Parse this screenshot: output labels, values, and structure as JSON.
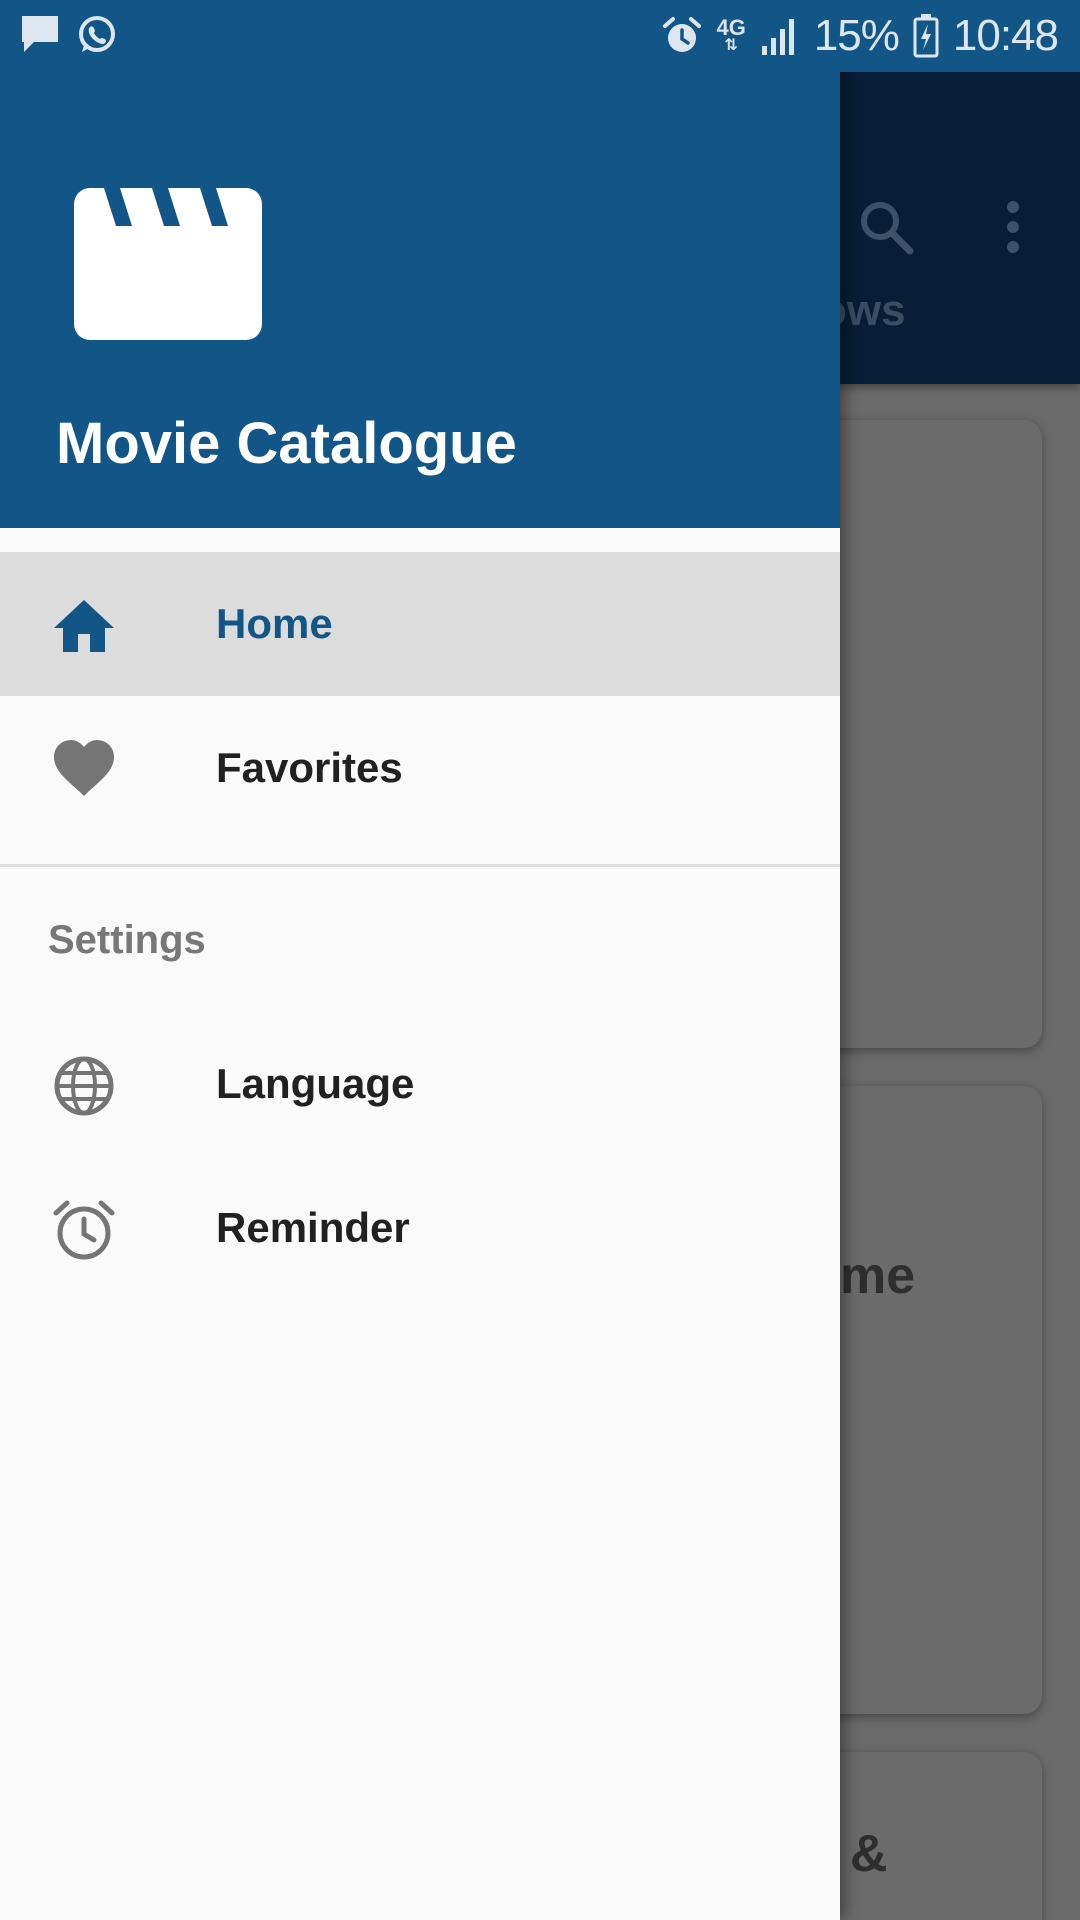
{
  "status_bar": {
    "network": "4G",
    "battery": "15%",
    "time": "10:48",
    "left_icons": [
      "message-icon",
      "whatsapp-icon"
    ],
    "right_icons": [
      "alarm-icon",
      "signal-icon",
      "battery-icon"
    ]
  },
  "background": {
    "tab_label_fragment": "ows",
    "card_text_fragments": [
      "me",
      "&"
    ],
    "icons": [
      "search-icon",
      "more-vert-icon"
    ]
  },
  "drawer": {
    "header": {
      "logo_icon": "clapperboard-icon",
      "title": "Movie Catalogue"
    },
    "items": [
      {
        "label": "Home",
        "icon": "home-icon",
        "selected": true
      },
      {
        "label": "Favorites",
        "icon": "heart-icon",
        "selected": false
      }
    ],
    "settings": {
      "title": "Settings",
      "items": [
        {
          "label": "Language",
          "icon": "globe-icon"
        },
        {
          "label": "Reminder",
          "icon": "alarm-clock-icon"
        }
      ]
    }
  },
  "colors": {
    "primary": "#125687",
    "toolbar_dimmed": "#071e36",
    "drawer_bg": "#fafafa",
    "selected_bg": "#dcdcdc",
    "icon_gray": "#757575",
    "text_dark": "#212121"
  }
}
